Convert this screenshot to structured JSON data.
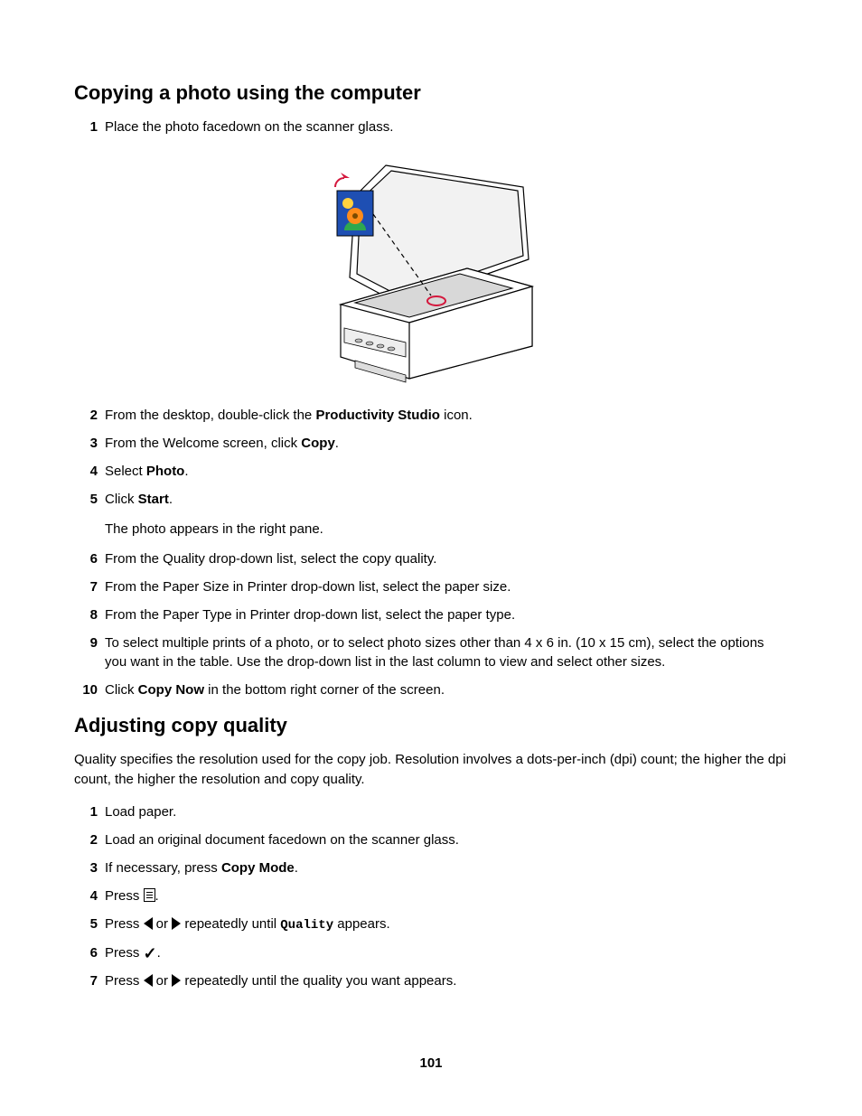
{
  "section1": {
    "heading": "Copying a photo using the computer",
    "steps": {
      "s1": {
        "num": "1",
        "text_a": "Place the photo facedown on the scanner glass."
      },
      "s2": {
        "num": "2",
        "text_a": "From the desktop, double-click the ",
        "bold": "Productivity Studio",
        "text_b": " icon."
      },
      "s3": {
        "num": "3",
        "text_a": "From the Welcome screen, click ",
        "bold": "Copy",
        "text_b": "."
      },
      "s4": {
        "num": "4",
        "text_a": "Select ",
        "bold": "Photo",
        "text_b": "."
      },
      "s5": {
        "num": "5",
        "text_a": "Click ",
        "bold": "Start",
        "text_b": ".",
        "sub": "The photo appears in the right pane."
      },
      "s6": {
        "num": "6",
        "text_a": "From the Quality drop-down list, select the copy quality."
      },
      "s7": {
        "num": "7",
        "text_a": "From the Paper Size in Printer drop-down list, select the paper size."
      },
      "s8": {
        "num": "8",
        "text_a": "From the Paper Type in Printer drop-down list, select the paper type."
      },
      "s9": {
        "num": "9",
        "text_a": "To select multiple prints of a photo, or to select photo sizes other than 4 x 6 in. (10 x 15 cm), select the options you want in the table. Use the drop-down list in the last column to view and select other sizes."
      },
      "s10": {
        "num": "10",
        "text_a": "Click ",
        "bold": "Copy Now",
        "text_b": " in the bottom right corner of the screen."
      }
    }
  },
  "section2": {
    "heading": "Adjusting copy quality",
    "intro": "Quality specifies the resolution used for the copy job. Resolution involves a dots-per-inch (dpi) count; the higher the dpi count, the higher the resolution and copy quality.",
    "steps": {
      "s1": {
        "num": "1",
        "text_a": "Load paper."
      },
      "s2": {
        "num": "2",
        "text_a": "Load an original document facedown on the scanner glass."
      },
      "s3": {
        "num": "3",
        "text_a": "If necessary, press ",
        "bold": "Copy Mode",
        "text_b": "."
      },
      "s4": {
        "num": "4",
        "text_a": "Press ",
        "text_b": "."
      },
      "s5": {
        "num": "5",
        "text_a": "Press ",
        "mid": " or ",
        "text_b": " repeatedly until ",
        "mono": "Quality",
        "text_c": " appears."
      },
      "s6": {
        "num": "6",
        "text_a": "Press ",
        "text_b": "."
      },
      "s7": {
        "num": "7",
        "text_a": "Press ",
        "mid": " or ",
        "text_b": " repeatedly until the quality you want appears."
      }
    }
  },
  "page_number": "101"
}
